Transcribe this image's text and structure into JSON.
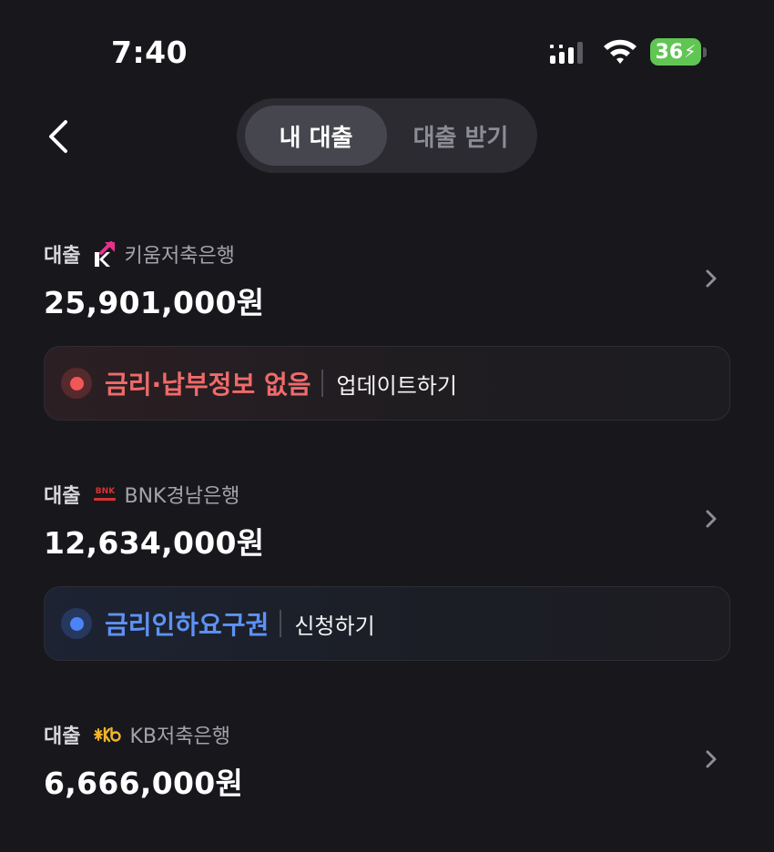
{
  "status_bar": {
    "time": "7:40",
    "battery": "36"
  },
  "header": {
    "tabs": [
      "내 대출",
      "대출 받기"
    ],
    "active_tab": "내 대출"
  },
  "loans": [
    {
      "type": "대출",
      "bank": "키움저축은행",
      "amount": "25,901,000원",
      "notice": {
        "title": "금리·납부정보 없음",
        "action": "업데이트하기",
        "color": "#f25757"
      }
    },
    {
      "type": "대출",
      "bank": "BNK경남은행",
      "bank_logo_text": "BNK",
      "amount": "12,634,000원",
      "notice": {
        "title": "금리인하요구권",
        "action": "신청하기",
        "color": "#4b84f6"
      }
    },
    {
      "type": "대출",
      "bank": "KB저축은행",
      "amount": "6,666,000원"
    }
  ],
  "colors": {
    "background": "#17171c",
    "segment_bg": "#2b2b31",
    "segment_active": "#46464e"
  }
}
